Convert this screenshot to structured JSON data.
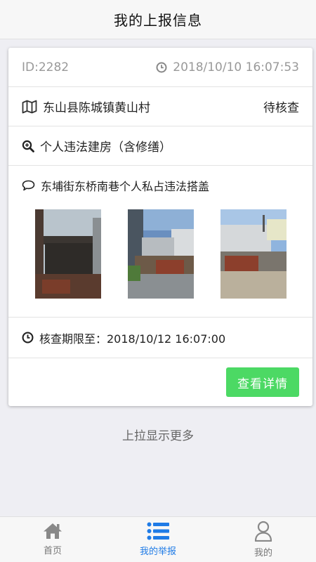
{
  "header": {
    "title": "我的上报信息"
  },
  "report": {
    "id": "ID:2282",
    "time": "2018/10/10 16:07:53",
    "location": "东山县陈城镇黄山村",
    "status": "待核查",
    "category": "个人违法建房（含修缮）",
    "description": "东埔街东桥南巷个人私占违法搭盖",
    "deadline": "核查期限至：2018/10/12 16:07:00",
    "detail_button": "查看详情",
    "photos": [
      "photo-1",
      "photo-2",
      "photo-3"
    ]
  },
  "load_more": "上拉显示更多",
  "tabbar": {
    "items": [
      {
        "label": "首页",
        "icon": "home-icon",
        "active": false
      },
      {
        "label": "我的举报",
        "icon": "list-icon",
        "active": true
      },
      {
        "label": "我的",
        "icon": "user-icon",
        "active": false
      }
    ]
  },
  "colors": {
    "accent": "#1f7be6",
    "button": "#4cd964",
    "background": "#eeeef3"
  }
}
